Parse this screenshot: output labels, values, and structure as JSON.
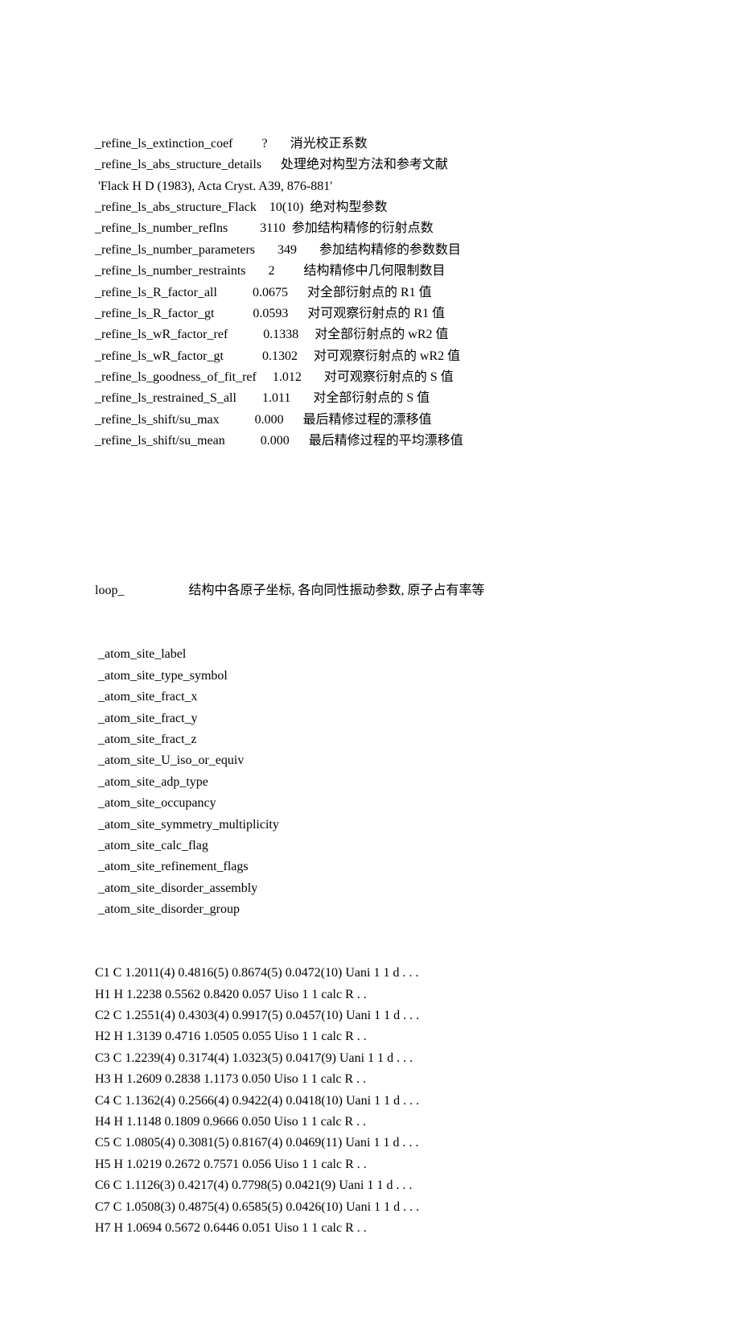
{
  "section1": {
    "lines": [
      "_refine_ls_extinction_coef         ?       消光校正系数",
      "_refine_ls_abs_structure_details      处理绝对构型方法和参考文献",
      " 'Flack H D (1983), Acta Cryst. A39, 876-881'",
      "_refine_ls_abs_structure_Flack    10(10)  绝对构型参数",
      "_refine_ls_number_reflns          3110  参加结构精修的衍射点数",
      "_refine_ls_number_parameters       349       参加结构精修的参数数目",
      "_refine_ls_number_restraints       2         结构精修中几何限制数目",
      "_refine_ls_R_factor_all           0.0675      对全部衍射点的 R1 值",
      "_refine_ls_R_factor_gt            0.0593      对可观察衍射点的 R1 值",
      "_refine_ls_wR_factor_ref           0.1338     对全部衍射点的 wR2 值",
      "_refine_ls_wR_factor_gt            0.1302     对可观察衍射点的 wR2 值",
      "_refine_ls_goodness_of_fit_ref     1.012       对可观察衍射点的 S 值",
      "_refine_ls_restrained_S_all        1.011       对全部衍射点的 S 值",
      "_refine_ls_shift/su_max           0.000      最后精修过程的漂移值",
      "_refine_ls_shift/su_mean           0.000      最后精修过程的平均漂移值"
    ]
  },
  "section2": {
    "header": "loop_                    结构中各原子坐标, 各向同性振动参数, 原子占有率等",
    "fields": [
      " _atom_site_label",
      " _atom_site_type_symbol",
      " _atom_site_fract_x",
      " _atom_site_fract_y",
      " _atom_site_fract_z",
      " _atom_site_U_iso_or_equiv",
      " _atom_site_adp_type",
      " _atom_site_occupancy",
      " _atom_site_symmetry_multiplicity",
      " _atom_site_calc_flag",
      " _atom_site_refinement_flags",
      " _atom_site_disorder_assembly",
      " _atom_site_disorder_group"
    ],
    "data": [
      "C1 C 1.2011(4) 0.4816(5) 0.8674(5) 0.0472(10) Uani 1 1 d . . .",
      "H1 H 1.2238 0.5562 0.8420 0.057 Uiso 1 1 calc R . .",
      "C2 C 1.2551(4) 0.4303(4) 0.9917(5) 0.0457(10) Uani 1 1 d . . .",
      "H2 H 1.3139 0.4716 1.0505 0.055 Uiso 1 1 calc R . .",
      "C3 C 1.2239(4) 0.3174(4) 1.0323(5) 0.0417(9) Uani 1 1 d . . .",
      "H3 H 1.2609 0.2838 1.1173 0.050 Uiso 1 1 calc R . .",
      "C4 C 1.1362(4) 0.2566(4) 0.9422(4) 0.0418(10) Uani 1 1 d . . .",
      "H4 H 1.1148 0.1809 0.9666 0.050 Uiso 1 1 calc R . .",
      "C5 C 1.0805(4) 0.3081(5) 0.8167(4) 0.0469(11) Uani 1 1 d . . .",
      "H5 H 1.0219 0.2672 0.7571 0.056 Uiso 1 1 calc R . .",
      "C6 C 1.1126(3) 0.4217(4) 0.7798(5) 0.0421(9) Uani 1 1 d . . .",
      "C7 C 1.0508(3) 0.4875(4) 0.6585(5) 0.0426(10) Uani 1 1 d . . .",
      "H7 H 1.0694 0.5672 0.6446 0.051 Uiso 1 1 calc R . ."
    ]
  }
}
